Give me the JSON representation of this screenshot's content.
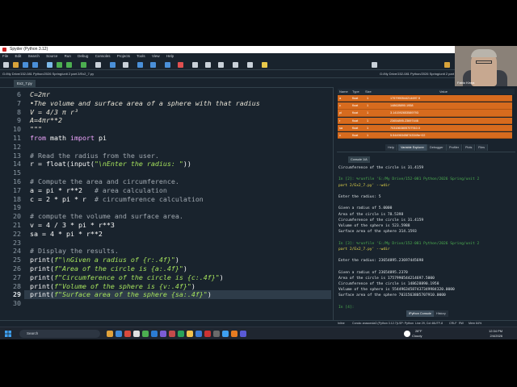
{
  "window": {
    "title": "Spyder (Python 3.12)"
  },
  "menu": [
    "File",
    "Edit",
    "Search",
    "Source",
    "Run",
    "Debug",
    "Consoles",
    "Projects",
    "Tools",
    "View",
    "Help"
  ],
  "path": {
    "left": "G:/My Drive/152-081 Python/2026 Spring/unit 2 part 2/Ex2_7.py",
    "right": "G:/My Drive/152-081 Python/2026 Spring/unit 2 part 2"
  },
  "editor": {
    "tab_label": "Ex2_7.py",
    "current_line": 29,
    "lines": [
      {
        "n": 6,
        "segments": [
          {
            "t": "C=2πr",
            "c": "doc"
          }
        ]
      },
      {
        "n": 7,
        "segments": [
          {
            "t": "•The volume and surface area of a sphere with that radius",
            "c": "doc"
          }
        ]
      },
      {
        "n": 8,
        "segments": [
          {
            "t": "V = 4/3 π r³",
            "c": "doc"
          }
        ]
      },
      {
        "n": 9,
        "segments": [
          {
            "t": "A=4πr**2",
            "c": "doc"
          }
        ]
      },
      {
        "n": 10,
        "segments": [
          {
            "t": "\"\"\"",
            "c": "doc"
          }
        ]
      },
      {
        "n": 11,
        "segments": [
          {
            "t": "from",
            "c": "kw"
          },
          {
            "t": " math ",
            "c": ""
          },
          {
            "t": "import",
            "c": "kw"
          },
          {
            "t": " pi",
            "c": ""
          }
        ]
      },
      {
        "n": 12,
        "segments": []
      },
      {
        "n": 13,
        "segments": [
          {
            "t": "# Read the radius from the user.",
            "c": "cmt"
          }
        ]
      },
      {
        "n": 14,
        "segments": [
          {
            "t": "r = float(input(",
            "c": ""
          },
          {
            "t": "\"\\nEnter the radius: \"",
            "c": "str"
          },
          {
            "t": "))",
            "c": ""
          }
        ]
      },
      {
        "n": 15,
        "segments": []
      },
      {
        "n": 16,
        "segments": [
          {
            "t": "# Compute the area and circumference.",
            "c": "cmt"
          }
        ]
      },
      {
        "n": 17,
        "segments": [
          {
            "t": "a = pi * r**2   ",
            "c": ""
          },
          {
            "t": "# area calculation",
            "c": "cmt"
          }
        ]
      },
      {
        "n": 18,
        "segments": [
          {
            "t": "c = 2 * pi * r  ",
            "c": ""
          },
          {
            "t": "# circumference calculation",
            "c": "cmt"
          }
        ]
      },
      {
        "n": 19,
        "segments": []
      },
      {
        "n": 20,
        "segments": [
          {
            "t": "# compute the volume and surface area.",
            "c": "cmt"
          }
        ]
      },
      {
        "n": 21,
        "segments": [
          {
            "t": "v = 4 / 3 * pi * r**3",
            "c": ""
          }
        ]
      },
      {
        "n": 22,
        "segments": [
          {
            "t": "sa = 4 * pi * r**2",
            "c": ""
          }
        ]
      },
      {
        "n": 23,
        "segments": []
      },
      {
        "n": 24,
        "segments": [
          {
            "t": "# Display the results.",
            "c": "cmt"
          }
        ]
      },
      {
        "n": 25,
        "segments": [
          {
            "t": "print(",
            "c": ""
          },
          {
            "t": "f\"\\nGiven a radius of {r:.4f}\"",
            "c": "str"
          },
          {
            "t": ")",
            "c": ""
          }
        ]
      },
      {
        "n": 26,
        "segments": [
          {
            "t": "print(",
            "c": ""
          },
          {
            "t": "f\"Area of the circle is {a:.4f}\"",
            "c": "str"
          },
          {
            "t": ")",
            "c": ""
          }
        ]
      },
      {
        "n": 27,
        "segments": [
          {
            "t": "print(",
            "c": ""
          },
          {
            "t": "f\"Circumference of the circle is {c:.4f}\"",
            "c": "str"
          },
          {
            "t": ")",
            "c": ""
          }
        ]
      },
      {
        "n": 28,
        "segments": [
          {
            "t": "print(",
            "c": ""
          },
          {
            "t": "f\"Volume of the sphere is {v:.4f}\"",
            "c": "str"
          },
          {
            "t": ")",
            "c": ""
          }
        ]
      },
      {
        "n": 29,
        "segments": [
          {
            "t": "print(",
            "c": ""
          },
          {
            "t": "f\"Surface area of the sphere {sa:.4f}\"",
            "c": "str"
          },
          {
            "t": ")",
            "c": ""
          }
        ]
      },
      {
        "n": 30,
        "segments": []
      }
    ]
  },
  "variables": {
    "headers": [
      "Name",
      "Type",
      "Size",
      "Value"
    ],
    "rows": [
      {
        "name": "a",
        "type": "float",
        "size": "1",
        "value": "1757990544214697.5"
      },
      {
        "name": "c",
        "type": "float",
        "size": "1",
        "value": "148628890.1958"
      },
      {
        "name": "pi",
        "type": "float",
        "size": "1",
        "value": "3.141592653589793"
      },
      {
        "name": "r",
        "type": "float",
        "size": "1",
        "value": "23654895.23697446"
      },
      {
        "name": "sa",
        "type": "float",
        "size": "1",
        "value": "7031563805707910.0"
      },
      {
        "name": "v",
        "type": "float",
        "size": "1",
        "value": "5.544963458743349e+22"
      }
    ],
    "tabs": [
      "Help",
      "Variable Explorer",
      "Debugger",
      "Profiler",
      "Plots",
      "Files"
    ],
    "active_tab": "Variable Explorer"
  },
  "console": {
    "tab_label": "Console 1/A",
    "lines": [
      {
        "t": "Circumference of the circle is 31.4159",
        "c": ""
      },
      {
        "t": "",
        "c": ""
      },
      {
        "t": "In [2]: %runfile 'G:/My Drive/152-081 Python/2026 Spring/unit 2",
        "c": "prompt"
      },
      {
        "t": "part 2/Ex2_7.py' --wdir",
        "c": "cpath"
      },
      {
        "t": "",
        "c": ""
      },
      {
        "t": "Enter the radius: 5",
        "c": ""
      },
      {
        "t": "",
        "c": ""
      },
      {
        "t": "Given a radius of 5.0000",
        "c": ""
      },
      {
        "t": "Area of the circle is 78.5398",
        "c": ""
      },
      {
        "t": "Circumference of the circle is 31.4159",
        "c": ""
      },
      {
        "t": "Volume of the sphere is 523.5988",
        "c": ""
      },
      {
        "t": "Surface area of the sphere 314.1593",
        "c": ""
      },
      {
        "t": "",
        "c": ""
      },
      {
        "t": "In [3]: %runfile 'G:/My Drive/152-081 Python/2026 Spring/unit 2",
        "c": "prompt"
      },
      {
        "t": "part 2/Ex2_7.py' --wdir",
        "c": "cpath"
      },
      {
        "t": "",
        "c": ""
      },
      {
        "t": "Enter the radius: 23654895.23697445698",
        "c": ""
      },
      {
        "t": "",
        "c": ""
      },
      {
        "t": "Given a radius of 23654895.2370",
        "c": ""
      },
      {
        "t": "Area of the circle is 1757990544214697.5000",
        "c": ""
      },
      {
        "t": "Circumference of the circle is 148628890.1958",
        "c": ""
      },
      {
        "t": "Volume of the sphere is 55449634587437349984320.0000",
        "c": ""
      },
      {
        "t": "Surface area of the sphere 7031563805707910.0000",
        "c": ""
      },
      {
        "t": "",
        "c": ""
      },
      {
        "t": "In [4]:",
        "c": "prompt"
      }
    ],
    "bottom_tabs": [
      "IPython Console",
      "History"
    ],
    "active_bottom_tab": "IPython Console"
  },
  "status": {
    "items": [
      "Inline",
      "Conda: anaconda3 (Python 3.12.7)",
      "LSP: Python",
      "Line 29, Col 46",
      "UTF-8",
      "CRLF",
      "RW",
      "Mem 64%"
    ]
  },
  "taskbar": {
    "search_placeholder": "Search",
    "weather_temp": "28°F",
    "weather_desc": "Cloudy",
    "time": "12:34 PM",
    "date": "2/4/2026"
  },
  "webcam": {
    "label": "Fabio Kinna"
  },
  "colors": {
    "editor_bg": "#19232d",
    "var_row": "#d76b1e",
    "string": "#a5e25c",
    "keyword": "#f0a6ff"
  }
}
